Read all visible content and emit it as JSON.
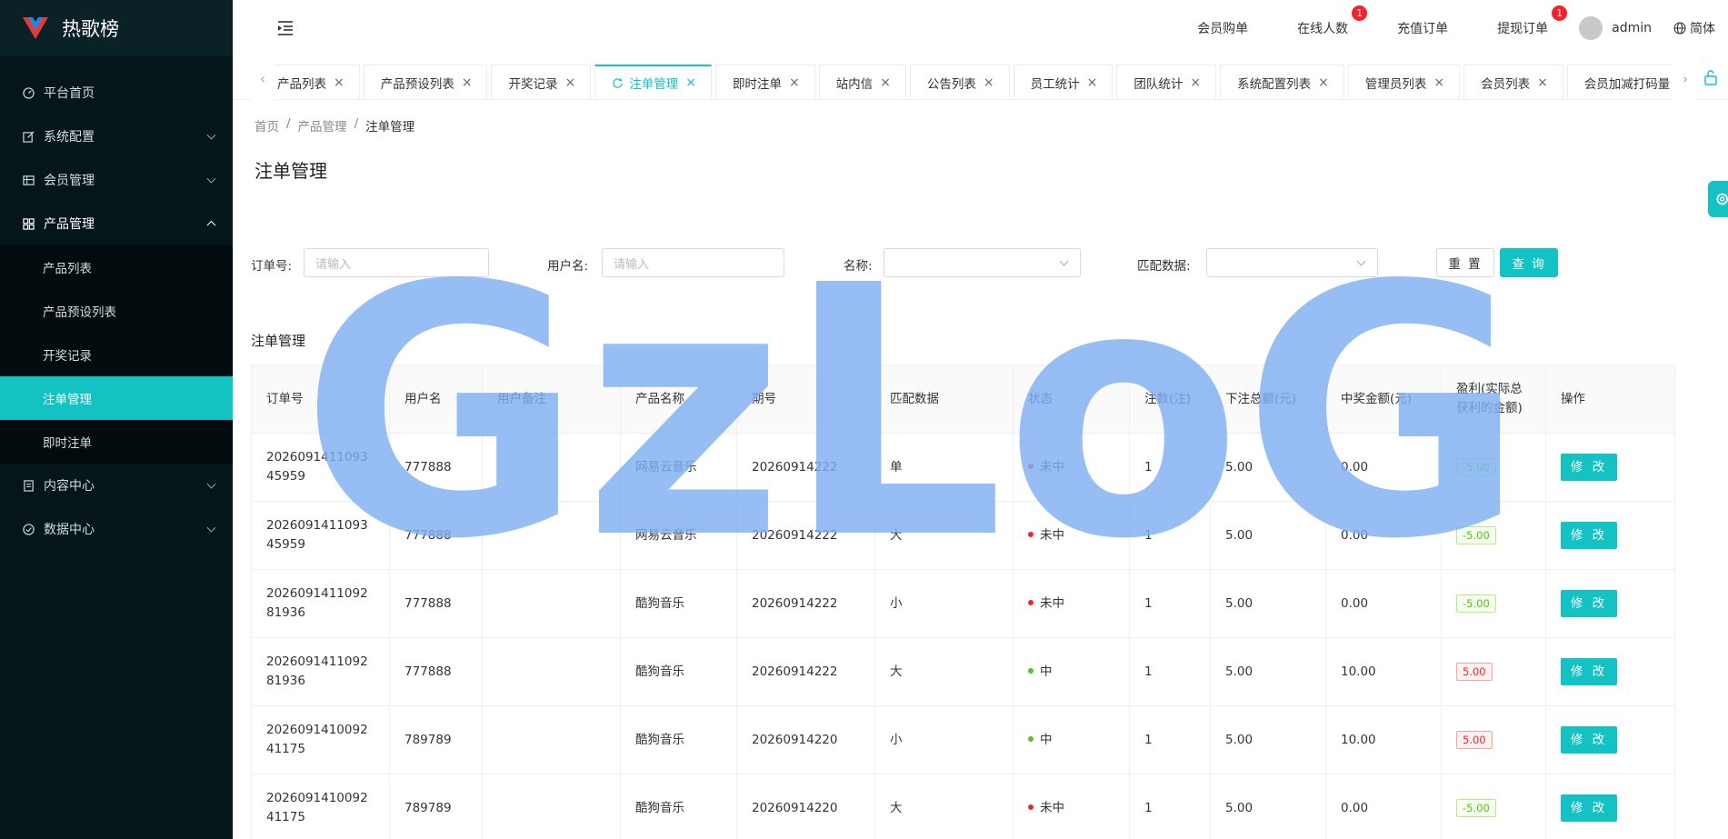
{
  "app": {
    "title": "热歌榜"
  },
  "sidebar": {
    "items": [
      {
        "label": "平台首页",
        "icon": "dashboard-icon"
      },
      {
        "label": "系统配置",
        "icon": "edit-icon"
      },
      {
        "label": "会员管理",
        "icon": "table-icon"
      },
      {
        "label": "产品管理",
        "icon": "grid-icon"
      },
      {
        "label": "内容中心",
        "icon": "document-icon"
      },
      {
        "label": "数据中心",
        "icon": "check-circle-icon"
      }
    ],
    "product_sub": [
      "产品列表",
      "产品预设列表",
      "开奖记录",
      "注单管理",
      "即时注单"
    ]
  },
  "header": {
    "links": [
      "会员购单",
      "在线人数",
      "充值订单",
      "提现订单"
    ],
    "online_badge": "1",
    "withdraw_badge": "1",
    "user": "admin",
    "lang": "简体"
  },
  "tabs": [
    "产品列表",
    "产品预设列表",
    "开奖记录",
    "注单管理",
    "即时注单",
    "站内信",
    "公告列表",
    "员工统计",
    "团队统计",
    "系统配置列表",
    "管理员列表",
    "会员列表",
    "会员加减打码量"
  ],
  "breadcrumb": [
    "首页",
    "产品管理",
    "注单管理"
  ],
  "page": {
    "title": "注单管理",
    "section_title": "注单管理"
  },
  "filters": {
    "order_label": "订单号:",
    "order_placeholder": "请输入",
    "user_label": "用户名:",
    "user_placeholder": "请输入",
    "name_label": "名称:",
    "match_label": "匹配数据:",
    "reset": "重 置",
    "query": "查 询"
  },
  "table": {
    "headers": [
      "订单号",
      "用户名",
      "用户备注",
      "产品名称",
      "期号",
      "匹配数据",
      "状态",
      "注数(注)",
      "下注总额(元)",
      "中奖金额(元)",
      "盈利(实际总获利的金额)",
      "操作"
    ],
    "edit_label": "修 改",
    "rows": [
      {
        "order": "202609141109345959",
        "user": "777888",
        "remark": "",
        "product": "网易云音乐",
        "period": "20260914222",
        "match": "单",
        "status": "未中",
        "count": "1",
        "bet": "5.00",
        "win": "0.00",
        "profit": "-5.00"
      },
      {
        "order": "202609141109345959",
        "user": "777888",
        "remark": "",
        "product": "网易云音乐",
        "period": "20260914222",
        "match": "大",
        "status": "未中",
        "count": "1",
        "bet": "5.00",
        "win": "0.00",
        "profit": "-5.00"
      },
      {
        "order": "202609141109281936",
        "user": "777888",
        "remark": "",
        "product": "酷狗音乐",
        "period": "20260914222",
        "match": "小",
        "status": "未中",
        "count": "1",
        "bet": "5.00",
        "win": "0.00",
        "profit": "-5.00"
      },
      {
        "order": "202609141109281936",
        "user": "777888",
        "remark": "",
        "product": "酷狗音乐",
        "period": "20260914222",
        "match": "大",
        "status": "中",
        "count": "1",
        "bet": "5.00",
        "win": "10.00",
        "profit": "5.00"
      },
      {
        "order": "202609141009241175",
        "user": "789789",
        "remark": "",
        "product": "酷狗音乐",
        "period": "20260914220",
        "match": "小",
        "status": "中",
        "count": "1",
        "bet": "5.00",
        "win": "10.00",
        "profit": "5.00"
      },
      {
        "order": "202609141009241175",
        "user": "789789",
        "remark": "",
        "product": "酷狗音乐",
        "period": "20260914220",
        "match": "大",
        "status": "未中",
        "count": "1",
        "bet": "5.00",
        "win": "0.00",
        "profit": "-5.00"
      }
    ]
  },
  "watermark": "GzLoG",
  "colors": {
    "accent": "#13c2c2",
    "sidebar_bg": "#05161a",
    "lose": "#f5222d",
    "win": "#52c41a"
  }
}
